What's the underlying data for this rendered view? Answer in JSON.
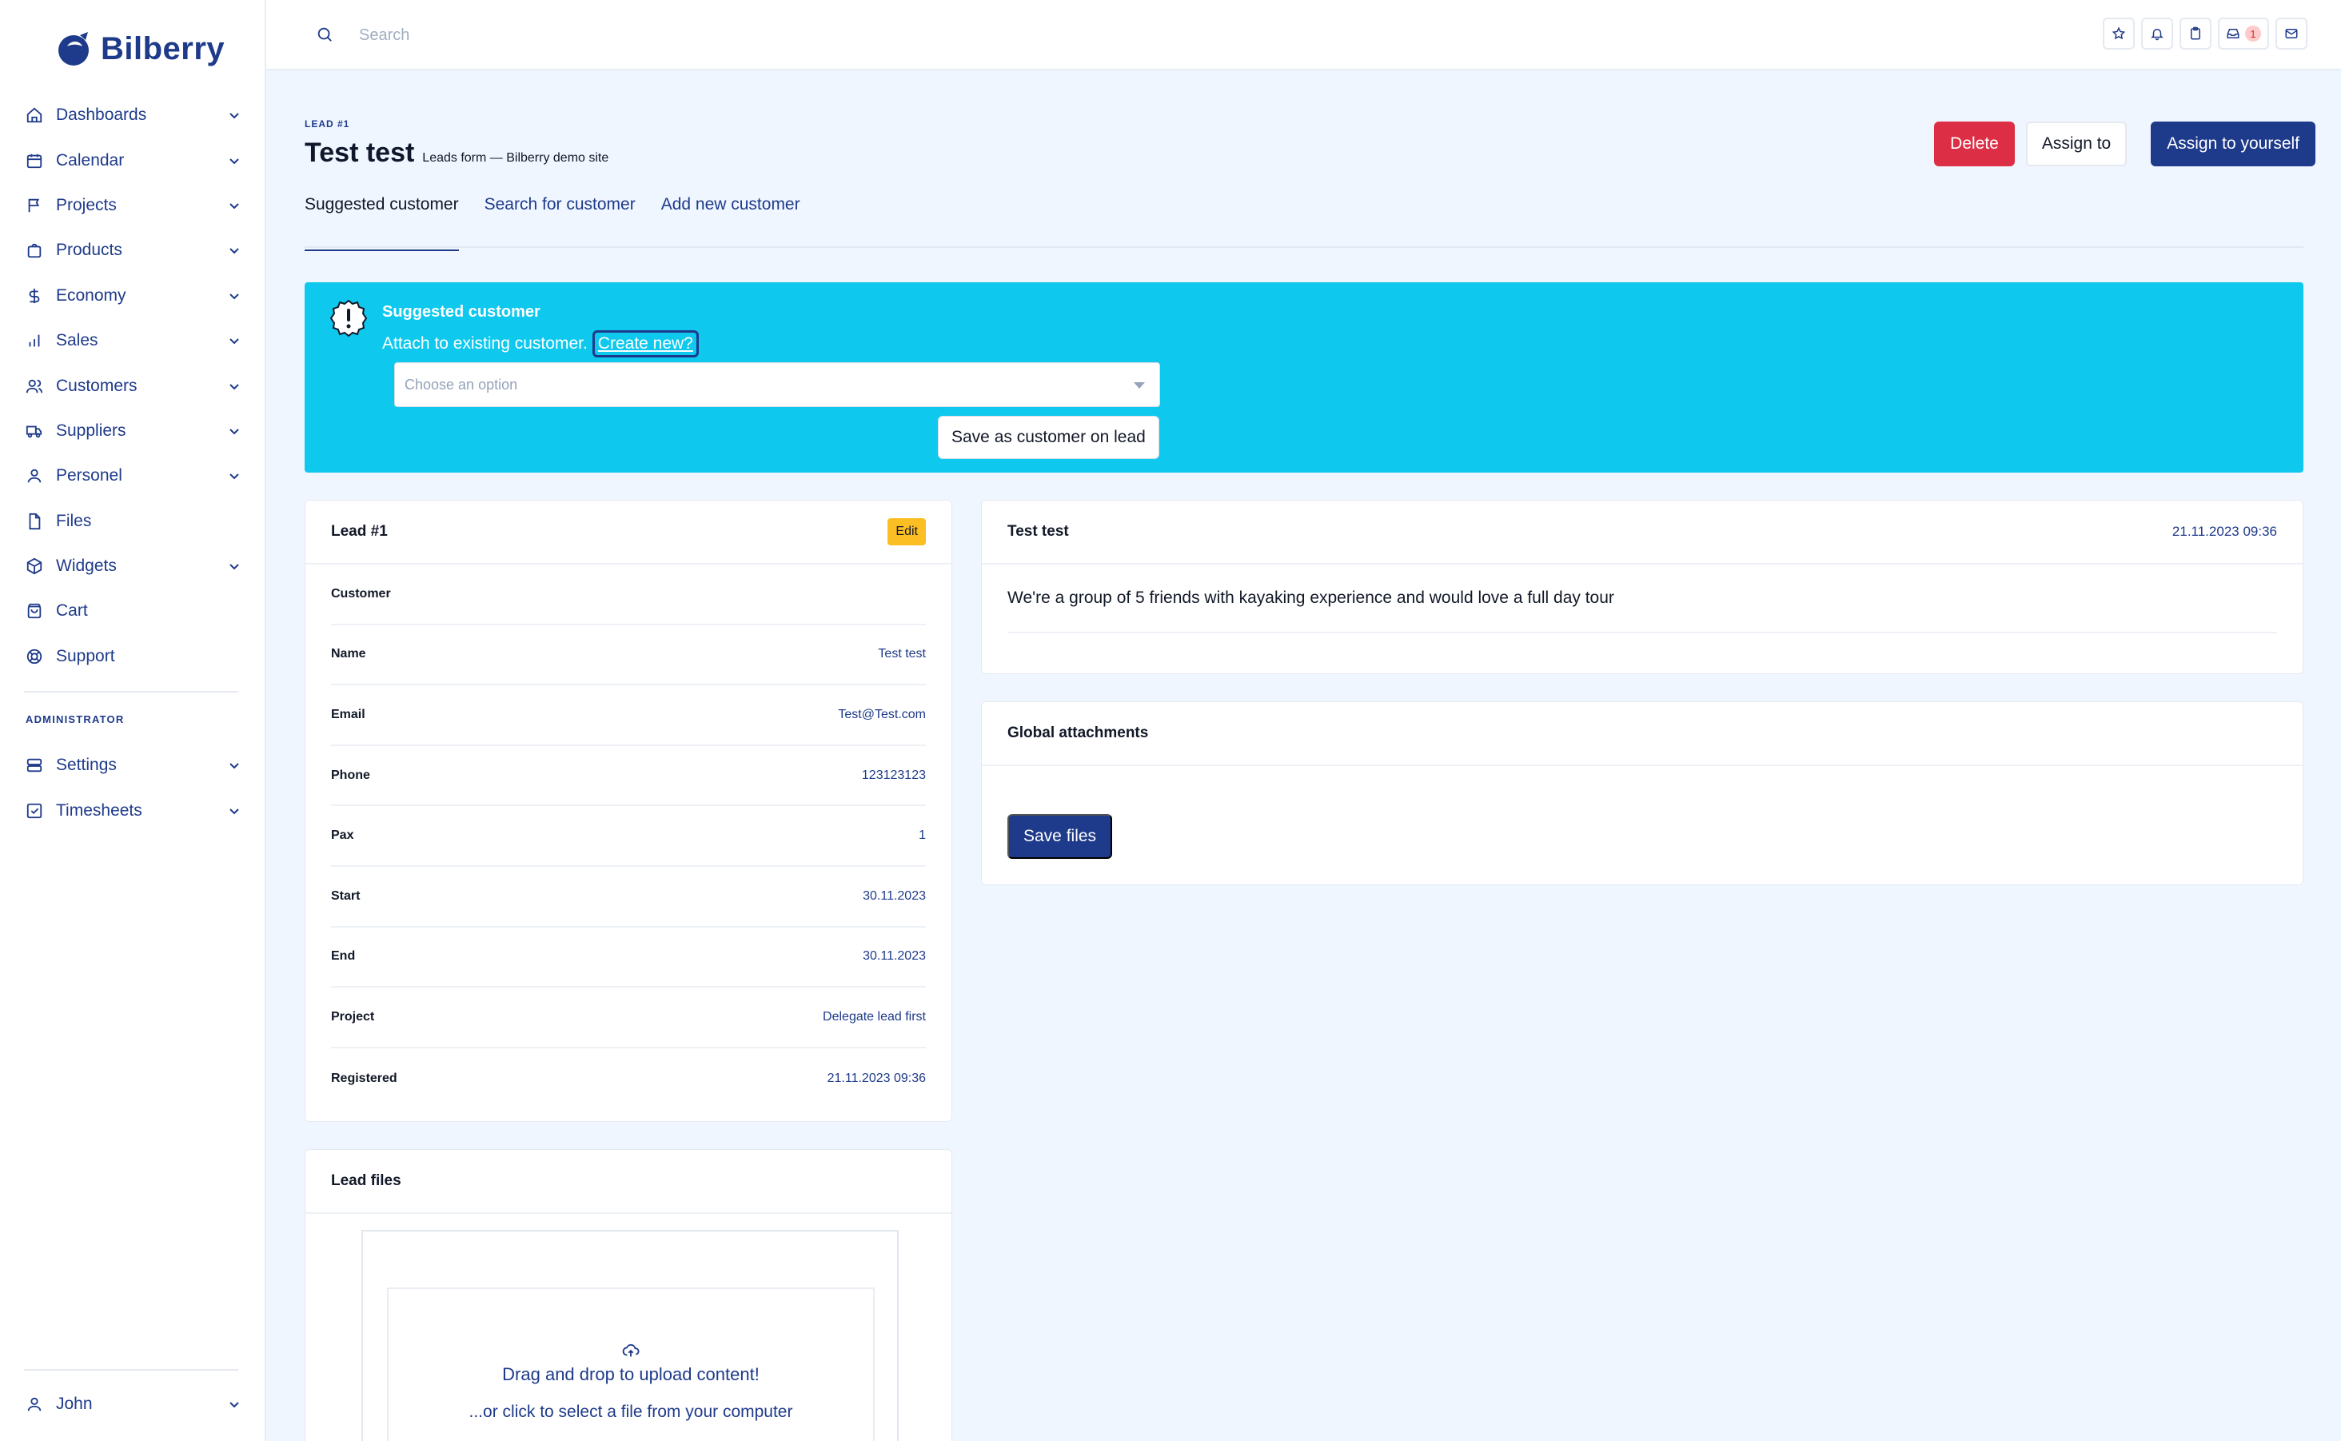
{
  "brand": {
    "name": "Bilberry",
    "color": "#1e3a8a"
  },
  "sidebar": {
    "items": [
      {
        "label": "Dashboards",
        "icon": "home-icon",
        "chevron": true
      },
      {
        "label": "Calendar",
        "icon": "calendar-icon",
        "chevron": true
      },
      {
        "label": "Projects",
        "icon": "flag-icon",
        "chevron": true
      },
      {
        "label": "Products",
        "icon": "bag-icon",
        "chevron": true
      },
      {
        "label": "Economy",
        "icon": "dollar-icon",
        "chevron": true
      },
      {
        "label": "Sales",
        "icon": "bar-chart-icon",
        "chevron": true
      },
      {
        "label": "Customers",
        "icon": "users-icon",
        "chevron": true
      },
      {
        "label": "Suppliers",
        "icon": "truck-icon",
        "chevron": true
      },
      {
        "label": "Personel",
        "icon": "user-icon",
        "chevron": true
      },
      {
        "label": "Files",
        "icon": "file-icon",
        "chevron": false
      },
      {
        "label": "Widgets",
        "icon": "cube-icon",
        "chevron": true
      },
      {
        "label": "Cart",
        "icon": "cart-icon",
        "chevron": false
      },
      {
        "label": "Support",
        "icon": "lifebuoy-icon",
        "chevron": false
      }
    ],
    "admin_section": "ADMINISTRATOR",
    "admin_items": [
      {
        "label": "Settings",
        "icon": "server-icon",
        "chevron": true
      },
      {
        "label": "Timesheets",
        "icon": "checkbox-icon",
        "chevron": true
      }
    ],
    "user": {
      "label": "John",
      "icon": "user-icon"
    }
  },
  "topbar": {
    "search_placeholder": "Search",
    "inbox_badge": "1"
  },
  "header": {
    "eyebrow": "LEAD #1",
    "title": "Test test",
    "subtitle": "Leads form — Bilberry demo site",
    "delete_label": "Delete",
    "assign_label": "Assign to",
    "assign_self_label": "Assign to yourself"
  },
  "tabs": [
    {
      "label": "Suggested customer",
      "active": true
    },
    {
      "label": "Search for customer",
      "active": false
    },
    {
      "label": "Add new customer",
      "active": false
    }
  ],
  "alert": {
    "title": "Suggested customer",
    "text": "Attach to existing customer.",
    "link": "Create new?",
    "select_placeholder": "Choose an option",
    "save_label": "Save as customer on lead",
    "bg_color": "#0ec8ee"
  },
  "lead_card": {
    "title": "Lead #1",
    "edit_label": "Edit",
    "section_label": "Customer",
    "rows": [
      {
        "key": "Name",
        "value": "Test test"
      },
      {
        "key": "Email",
        "value": "Test@Test.com"
      },
      {
        "key": "Phone",
        "value": "123123123"
      },
      {
        "key": "Pax",
        "value": "1"
      },
      {
        "key": "Start",
        "value": "30.11.2023"
      },
      {
        "key": "End",
        "value": "30.11.2023"
      },
      {
        "key": "Project",
        "value": "Delegate lead first"
      },
      {
        "key": "Registered",
        "value": "21.11.2023 09:36"
      }
    ]
  },
  "message_card": {
    "author": "Test test",
    "date": "21.11.2023 09:36",
    "body": "We're a group of 5 friends with kayaking experience and would love a full day tour"
  },
  "attachments_card": {
    "title": "Global attachments",
    "save_label": "Save files"
  },
  "files_card": {
    "title": "Lead files",
    "drop_title": "Drag and drop to upload content!",
    "drop_sub": "...or click to select a file from your computer"
  }
}
